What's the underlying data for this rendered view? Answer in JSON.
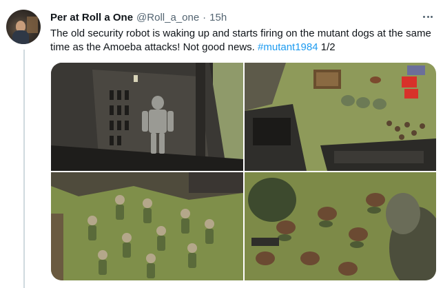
{
  "tweet": {
    "display_name": "Per at Roll a One",
    "handle": "@Roll_a_one",
    "separator": "·",
    "time": "15h",
    "text": "The old security robot is waking up and starts firing on the mutant dogs at the same time as the Amoeba attacks! Not good news.",
    "hashtag": "#mutant1984",
    "thread_count": "1/2"
  },
  "icons": {
    "avatar": "profile-avatar",
    "more": "more-options-icon"
  },
  "colors": {
    "hashtag": "#1d9bf0",
    "secondary_text": "#536471",
    "thread_line": "#cfd9de"
  },
  "media": {
    "photos": [
      "robot-miniature-ruined-building",
      "tabletop-overview-mutant-dogs",
      "mutant-miniatures-squad",
      "amoeba-attack-closeup"
    ]
  }
}
